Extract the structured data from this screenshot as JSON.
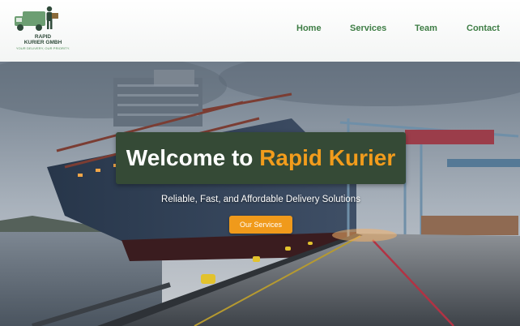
{
  "brand": {
    "name_line1": "RAPID",
    "name_line2": "KURIER GMBH",
    "tagline": "YOUR DELIVERY, OUR PRIORITY.",
    "color": "#3e7d45"
  },
  "nav": {
    "items": [
      {
        "label": "Home"
      },
      {
        "label": "Services"
      },
      {
        "label": "Team"
      },
      {
        "label": "Contact"
      }
    ]
  },
  "hero": {
    "title_prefix": "Welcome to",
    "title_accent": "Rapid Kurier",
    "subtitle": "Reliable, Fast, and Affordable Delivery Solutions",
    "cta_label": "Our Services",
    "accent_color": "#f29c1c",
    "box_color": "#354a36"
  }
}
